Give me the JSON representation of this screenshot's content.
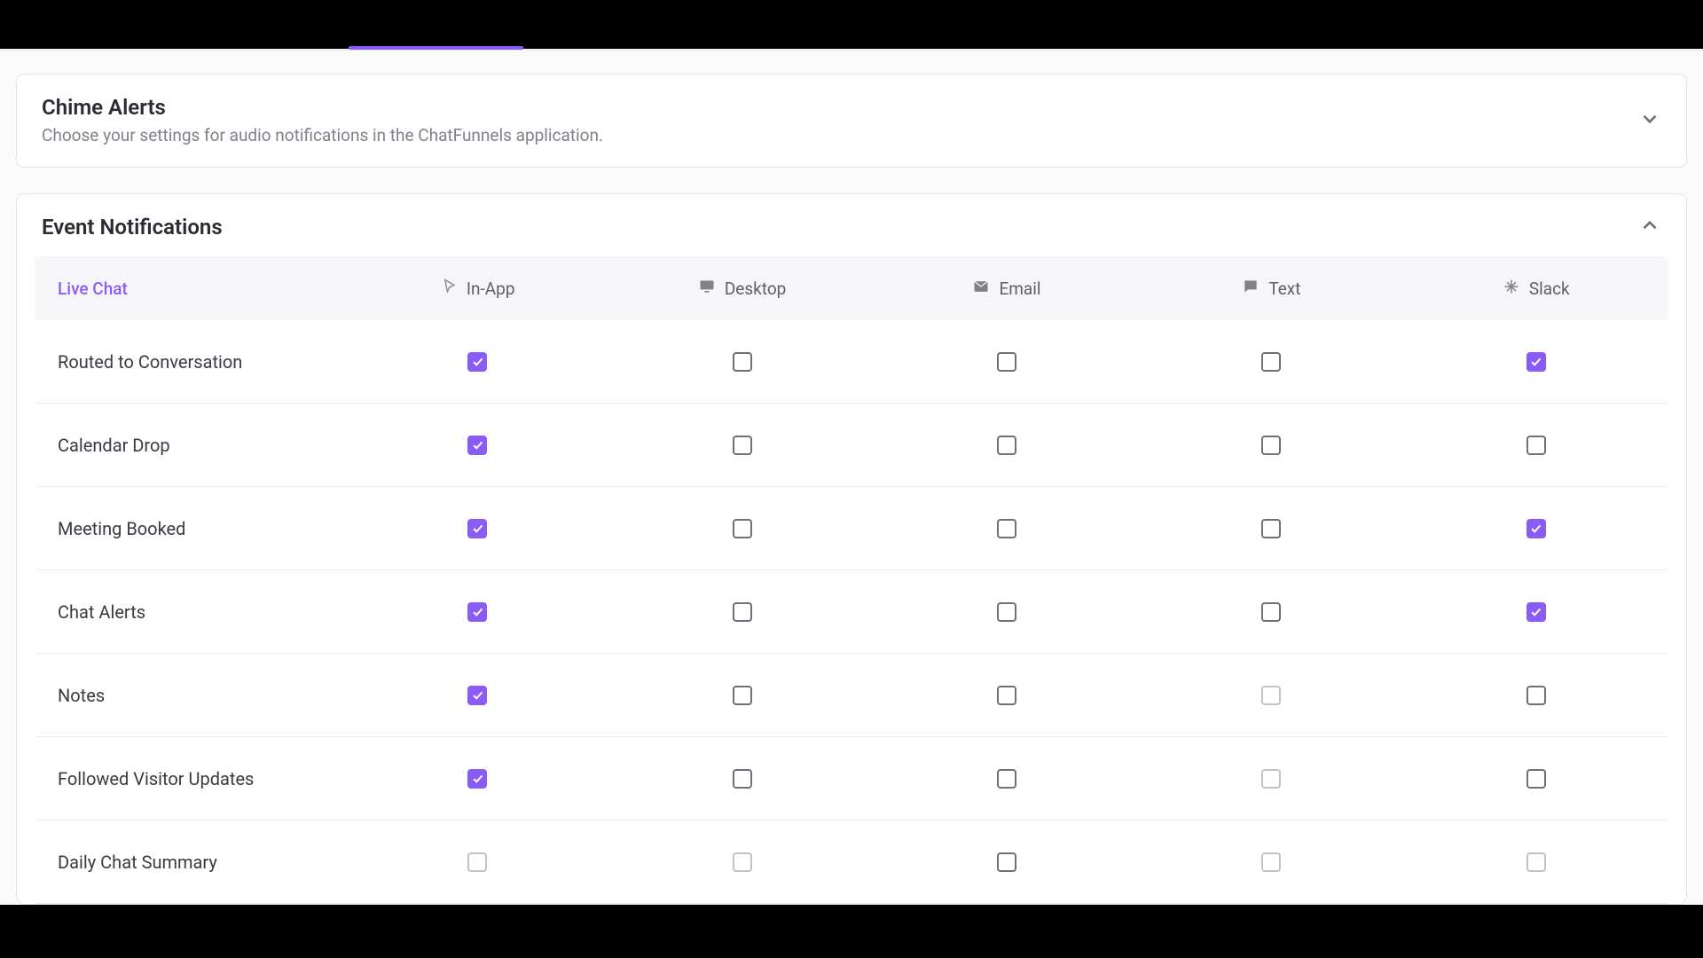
{
  "colors": {
    "accent": "#8a5cf5"
  },
  "chime": {
    "title": "Chime Alerts",
    "subtitle": "Choose your settings for audio notifications in the ChatFunnels application."
  },
  "events": {
    "title": "Event Notifications",
    "section_label": "Live Chat",
    "columns": [
      {
        "key": "inapp",
        "label": "In-App",
        "icon": "cursor-icon"
      },
      {
        "key": "desktop",
        "label": "Desktop",
        "icon": "monitor-icon"
      },
      {
        "key": "email",
        "label": "Email",
        "icon": "email-icon"
      },
      {
        "key": "text",
        "label": "Text",
        "icon": "chat-icon"
      },
      {
        "key": "slack",
        "label": "Slack",
        "icon": "slack-icon"
      }
    ],
    "rows": [
      {
        "label": "Routed to Conversation",
        "cells": [
          "checked",
          "unchecked",
          "unchecked",
          "unchecked",
          "checked"
        ]
      },
      {
        "label": "Calendar Drop",
        "cells": [
          "checked",
          "unchecked",
          "unchecked",
          "unchecked",
          "unchecked"
        ]
      },
      {
        "label": "Meeting Booked",
        "cells": [
          "checked",
          "unchecked",
          "unchecked",
          "unchecked",
          "checked"
        ]
      },
      {
        "label": "Chat Alerts",
        "cells": [
          "checked",
          "unchecked",
          "unchecked",
          "unchecked",
          "checked"
        ]
      },
      {
        "label": "Notes",
        "cells": [
          "checked",
          "unchecked",
          "unchecked",
          "disabled",
          "unchecked"
        ]
      },
      {
        "label": "Followed Visitor Updates",
        "cells": [
          "checked",
          "unchecked",
          "unchecked",
          "disabled",
          "unchecked"
        ]
      },
      {
        "label": "Daily Chat Summary",
        "cells": [
          "disabled",
          "disabled",
          "unchecked",
          "disabled",
          "disabled"
        ]
      }
    ]
  }
}
